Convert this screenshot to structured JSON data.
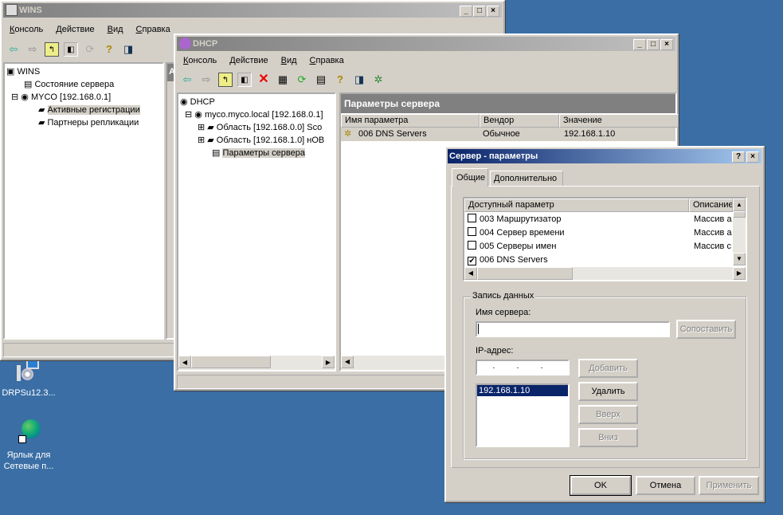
{
  "desktop": {
    "icons": [
      {
        "label": "DRPSu12.3...",
        "icon": "installer-cd-icon"
      },
      {
        "label_line1": "Ярлык для",
        "label_line2": "Сетевые п...",
        "icon": "network-globe-shortcut-icon"
      }
    ],
    "background": "#3a6ea5"
  },
  "wins": {
    "title": "WINS",
    "menu": [
      "Консоль",
      "Действие",
      "Вид",
      "Справка"
    ],
    "tree": {
      "root": "WINS",
      "items": [
        "Состояние сервера",
        "MYCO [192.168.0.1]",
        "Активные регистрации",
        "Партнеры репликации"
      ]
    },
    "right_header": "А"
  },
  "dhcp": {
    "title": "DHCP",
    "menu": [
      "Консоль",
      "Действие",
      "Вид",
      "Справка"
    ],
    "tree": {
      "root": "DHCP",
      "server": "myco.myco.local [192.168.0.1]",
      "scopes": [
        "Область [192.168.0.0] Sco",
        "Область [192.168.1.0] нОВ"
      ],
      "options": "Параметры сервера"
    },
    "pane_title": "Параметры сервера",
    "columns": [
      "Имя параметра",
      "Вендор",
      "Значение"
    ],
    "rows": [
      {
        "name": "006 DNS Servers",
        "vendor": "Обычное",
        "value": "192.168.1.10"
      }
    ]
  },
  "dialog": {
    "title": "Сервер - параметры",
    "help": "?",
    "close": "×",
    "tabs": [
      "Общие",
      "Дополнительно"
    ],
    "list_columns": [
      "Доступный параметр",
      "Описание"
    ],
    "options": [
      {
        "label": "003 Маршрутизатор",
        "desc": "Массив а",
        "checked": false
      },
      {
        "label": "004 Сервер времени",
        "desc": "Массив а",
        "checked": false
      },
      {
        "label": "005 Серверы имен",
        "desc": "Массив с",
        "checked": false
      },
      {
        "label": "006 DNS Servers",
        "desc": "",
        "checked": true
      }
    ],
    "group": "Запись данных",
    "server_name_label": "Имя сервера:",
    "server_name_value": "",
    "resolve": "Сопоставить",
    "ip_label": "IP-адрес:",
    "ip_value": ". . .",
    "ip_list": [
      "192.168.1.10"
    ],
    "add": "Добавить",
    "remove": "Удалить",
    "up": "Вверх",
    "down": "Вниз",
    "ok": "OK",
    "cancel": "Отмена",
    "apply": "Применить"
  }
}
